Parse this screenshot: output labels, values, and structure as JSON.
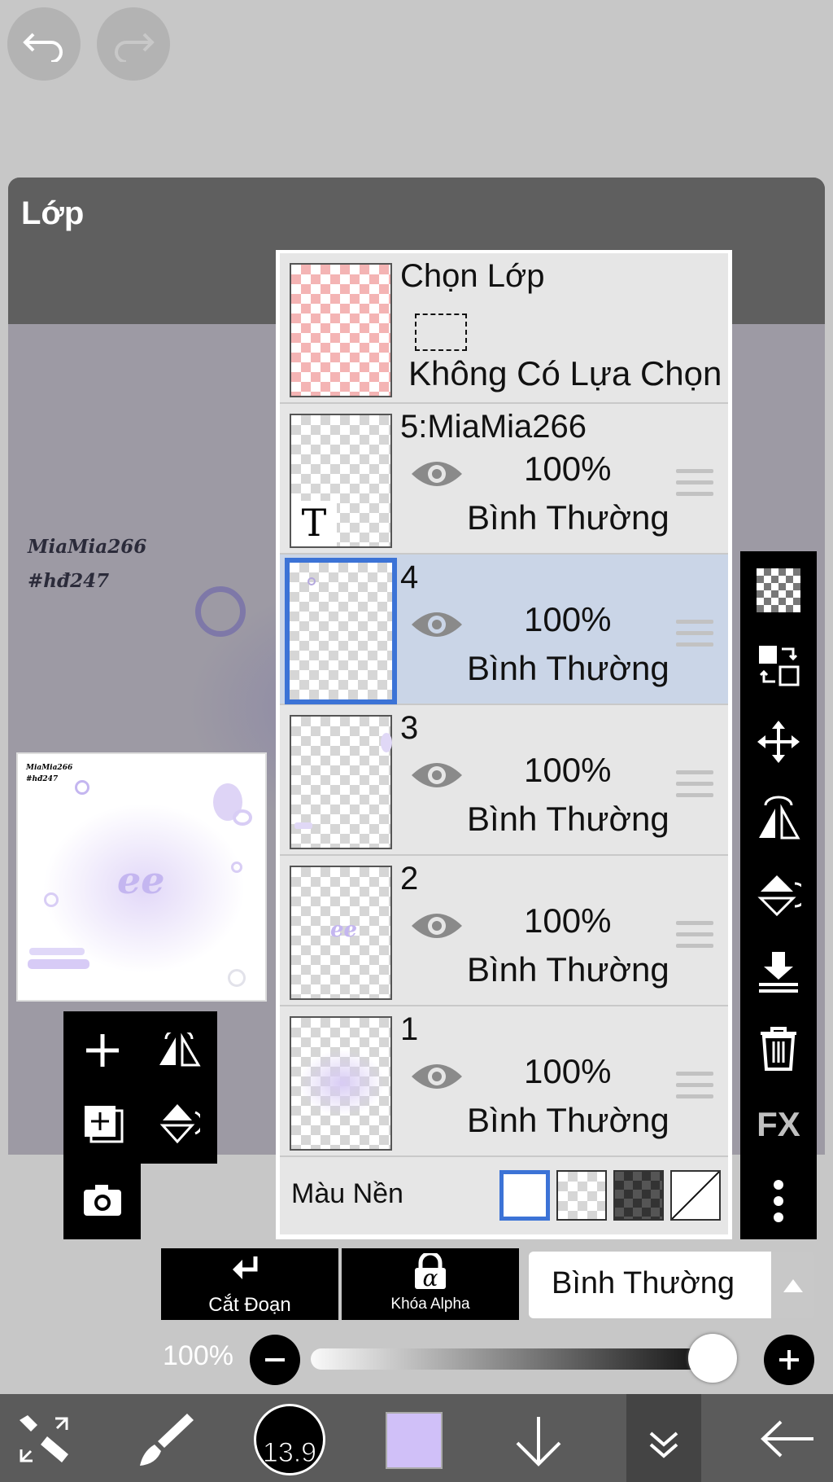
{
  "panel": {
    "title": "Lớp"
  },
  "canvas": {
    "watermark_line1": "MiaMia266",
    "watermark_line2": "#hđ247",
    "thumb_line1": "MiaMia266",
    "thumb_line2": "#hđ247",
    "thumb_center": "ee"
  },
  "selection": {
    "title": "Chọn Lớp",
    "subtitle": "Không Có Lựa Chọn"
  },
  "layers": [
    {
      "name": "5:MiaMia266",
      "opacity": "100%",
      "blend": "Bình Thường",
      "thumb_text": "T"
    },
    {
      "name": "4",
      "opacity": "100%",
      "blend": "Bình Thường",
      "selected": true
    },
    {
      "name": "3",
      "opacity": "100%",
      "blend": "Bình Thường"
    },
    {
      "name": "2",
      "opacity": "100%",
      "blend": "Bình Thường",
      "thumb_text": "ee"
    },
    {
      "name": "1",
      "opacity": "100%",
      "blend": "Bình Thường"
    }
  ],
  "background": {
    "label": "Màu Nền"
  },
  "actions": {
    "clip_label": "Cắt Đoạn",
    "alpha_label": "Khóa Alpha",
    "alpha_symbol": "α",
    "blend_mode": "Bình Thường"
  },
  "opacity_slider": {
    "label": "100%",
    "value": 1.0
  },
  "right_tools": {
    "fx_label": "FX"
  },
  "bottom_bar": {
    "brush_size": "13.9",
    "color": "#d0c0f8"
  },
  "colors": {
    "accent": "#3c73d6",
    "selected_row": "#cad5e7"
  }
}
